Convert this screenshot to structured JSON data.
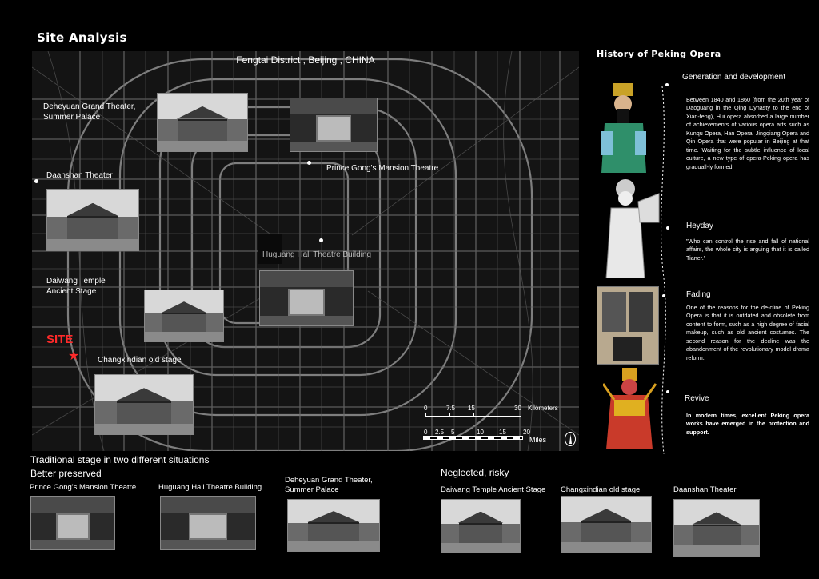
{
  "page_title": "Site Analysis",
  "map": {
    "title": "Fengtai District , Beijing , CHINA",
    "site_label": "SITE",
    "labels": {
      "deheyuan": "Deheyuan Grand Theater,\nSummer Palace",
      "daanshan": "Daanshan Theater",
      "prince_gong": "Prince Gong's Mansion Theatre",
      "huguang": "Huguang Hall Theatre Building",
      "daiwang": "Daiwang Temple\nAncient Stage",
      "changxindian": "Changxindian old stage"
    },
    "scale": {
      "km_unit": "Kilometers",
      "km_ticks": [
        "0",
        "7.5",
        "15",
        "30"
      ],
      "mi_unit": "Miles",
      "mi_ticks": [
        "0",
        "2.5",
        "5",
        "10",
        "15",
        "20"
      ]
    }
  },
  "history": {
    "title": "History of Peking Opera",
    "sections": [
      {
        "heading": "Generation and development",
        "text": "Between 1840 and 1860 (from the 20th year of Daoguang in the Qing Dynasty to the end of Xian-feng), Hui opera absorbed a large number of achievements of various opera arts such as Kunqu Opera, Han Opera, Jingqiang Opera and Qin Opera that were popular in Beijing at that time. Waiting for the subtle influence of local culture, a new type of opera-Peking opera has graduall-ly formed."
      },
      {
        "heading": "Heyday",
        "text": "\"Who can control the rise and fall of national affairs, the whole city is arguing that it is called Tianer.\""
      },
      {
        "heading": "Fading",
        "text": "One of the reasons for the de-cline of Peking Opera is that it is outdated and obsolete from content to form, such as a high degree of facial makeup, such as old ancient costumes. The second reason for the decline was the abandonment of the revolutionary model drama reform."
      },
      {
        "heading": "Revive",
        "text": "In modern times, excellent Peking opera works have emerged in the protection and support."
      }
    ]
  },
  "bottom": {
    "main_title": "Traditional stage in two different situations",
    "better_title": "Better preserved",
    "neglected_title": "Neglected, risky",
    "better_items": [
      "Prince Gong's Mansion Theatre",
      "Huguang Hall Theatre Building",
      "Deheyuan Grand Theater,\nSummer Palace"
    ],
    "neglected_items": [
      "Daiwang Temple Ancient Stage",
      "Changxindian old stage",
      "Daanshan Theater"
    ]
  },
  "colors": {
    "background": "#000000",
    "map_bg": "#141414",
    "roads": "#9a9a9a",
    "site": "#ff2a2a"
  }
}
